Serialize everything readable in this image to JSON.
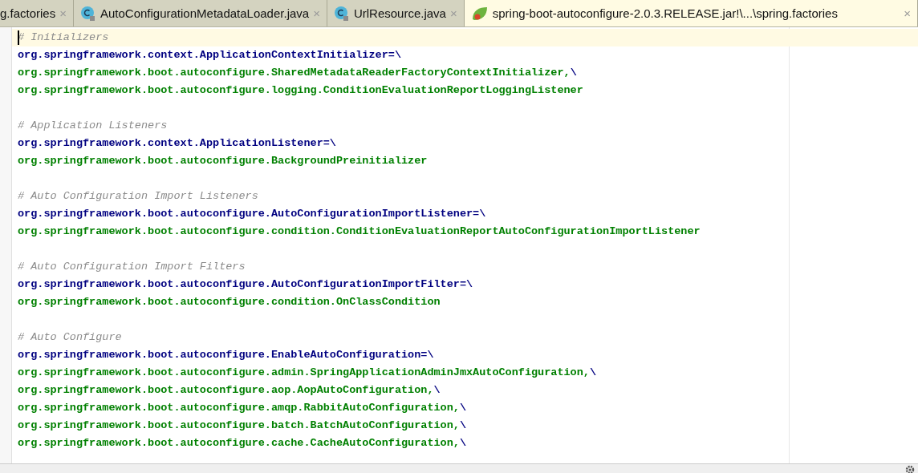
{
  "tabs": [
    {
      "label": "g.factories",
      "kind": "plain",
      "close": "×",
      "selected": false
    },
    {
      "label": "AutoConfigurationMetadataLoader.java",
      "kind": "class",
      "close": "×",
      "selected": false
    },
    {
      "label": "UrlResource.java",
      "kind": "class",
      "close": "×",
      "selected": false
    },
    {
      "label": "spring-boot-autoconfigure-2.0.3.RELEASE.jar!\\...\\spring.factories",
      "kind": "spring",
      "close": "×",
      "selected": true
    }
  ],
  "editor": {
    "lines": [
      {
        "kind": "comment",
        "text": "# Initializers",
        "current": true
      },
      {
        "kind": "key",
        "text": "org.springframework.context.ApplicationContextInitializer",
        "suffix": "=\\"
      },
      {
        "kind": "value",
        "text": "org.springframework.boot.autoconfigure.SharedMetadataReaderFactoryContextInitializer,",
        "suffix": "\\"
      },
      {
        "kind": "value",
        "text": "org.springframework.boot.autoconfigure.logging.ConditionEvaluationReportLoggingListener"
      },
      {
        "kind": "blank"
      },
      {
        "kind": "comment",
        "text": "# Application Listeners"
      },
      {
        "kind": "key",
        "text": "org.springframework.context.ApplicationListener",
        "suffix": "=\\"
      },
      {
        "kind": "value",
        "text": "org.springframework.boot.autoconfigure.BackgroundPreinitializer"
      },
      {
        "kind": "blank"
      },
      {
        "kind": "comment",
        "text": "# Auto Configuration Import Listeners"
      },
      {
        "kind": "key",
        "text": "org.springframework.boot.autoconfigure.AutoConfigurationImportListener",
        "suffix": "=\\"
      },
      {
        "kind": "value",
        "text": "org.springframework.boot.autoconfigure.condition.ConditionEvaluationReportAutoConfigurationImportListener"
      },
      {
        "kind": "blank"
      },
      {
        "kind": "comment",
        "text": "# Auto Configuration Import Filters"
      },
      {
        "kind": "key",
        "text": "org.springframework.boot.autoconfigure.AutoConfigurationImportFilter",
        "suffix": "=\\"
      },
      {
        "kind": "value",
        "text": "org.springframework.boot.autoconfigure.condition.OnClassCondition"
      },
      {
        "kind": "blank"
      },
      {
        "kind": "comment",
        "text": "# Auto Configure"
      },
      {
        "kind": "key",
        "text": "org.springframework.boot.autoconfigure.EnableAutoConfiguration",
        "suffix": "=\\"
      },
      {
        "kind": "value",
        "text": "org.springframework.boot.autoconfigure.admin.SpringApplicationAdminJmxAutoConfiguration,",
        "suffix": "\\"
      },
      {
        "kind": "value",
        "text": "org.springframework.boot.autoconfigure.aop.AopAutoConfiguration,",
        "suffix": "\\"
      },
      {
        "kind": "value",
        "text": "org.springframework.boot.autoconfigure.amqp.RabbitAutoConfiguration,",
        "suffix": "\\"
      },
      {
        "kind": "value",
        "text": "org.springframework.boot.autoconfigure.batch.BatchAutoConfiguration,",
        "suffix": "\\"
      },
      {
        "kind": "value",
        "text": "org.springframework.boot.autoconfigure.cache.CacheAutoConfiguration,",
        "suffix": "\\"
      }
    ]
  }
}
